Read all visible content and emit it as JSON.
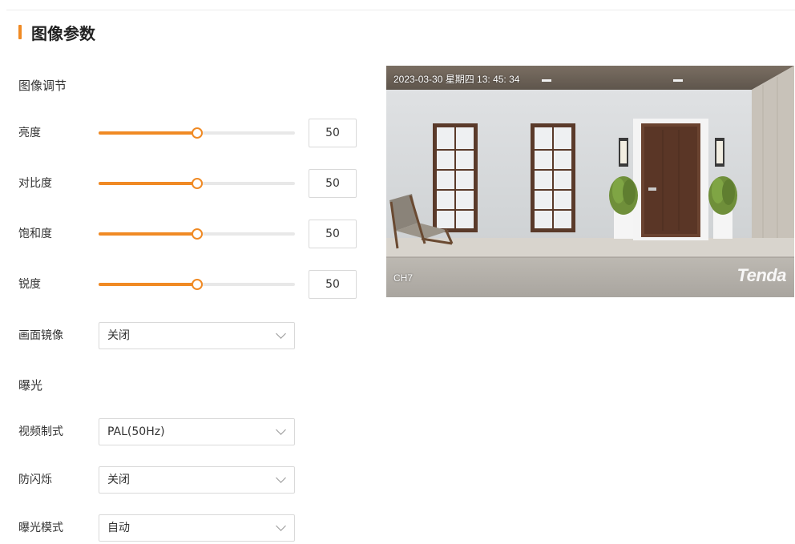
{
  "page": {
    "title": "图像参数"
  },
  "image_adjust": {
    "section_label": "图像调节",
    "sliders": [
      {
        "label": "亮度",
        "value": 50,
        "max": 100
      },
      {
        "label": "对比度",
        "value": 50,
        "max": 100
      },
      {
        "label": "饱和度",
        "value": 50,
        "max": 100
      },
      {
        "label": "锐度",
        "value": 50,
        "max": 100
      }
    ],
    "mirror": {
      "label": "画面镜像",
      "value": "关闭"
    }
  },
  "exposure": {
    "section_label": "曝光",
    "video_standard": {
      "label": "视频制式",
      "value": "PAL(50Hz)"
    },
    "anti_flicker": {
      "label": "防闪烁",
      "value": "关闭"
    },
    "exposure_mode": {
      "label": "曝光模式",
      "value": "自动"
    }
  },
  "preview": {
    "timestamp": "2023-03-30 星期四 13: 45: 34",
    "channel": "CH7",
    "logo": "Tenda"
  },
  "colors": {
    "accent": "#f08a24"
  }
}
